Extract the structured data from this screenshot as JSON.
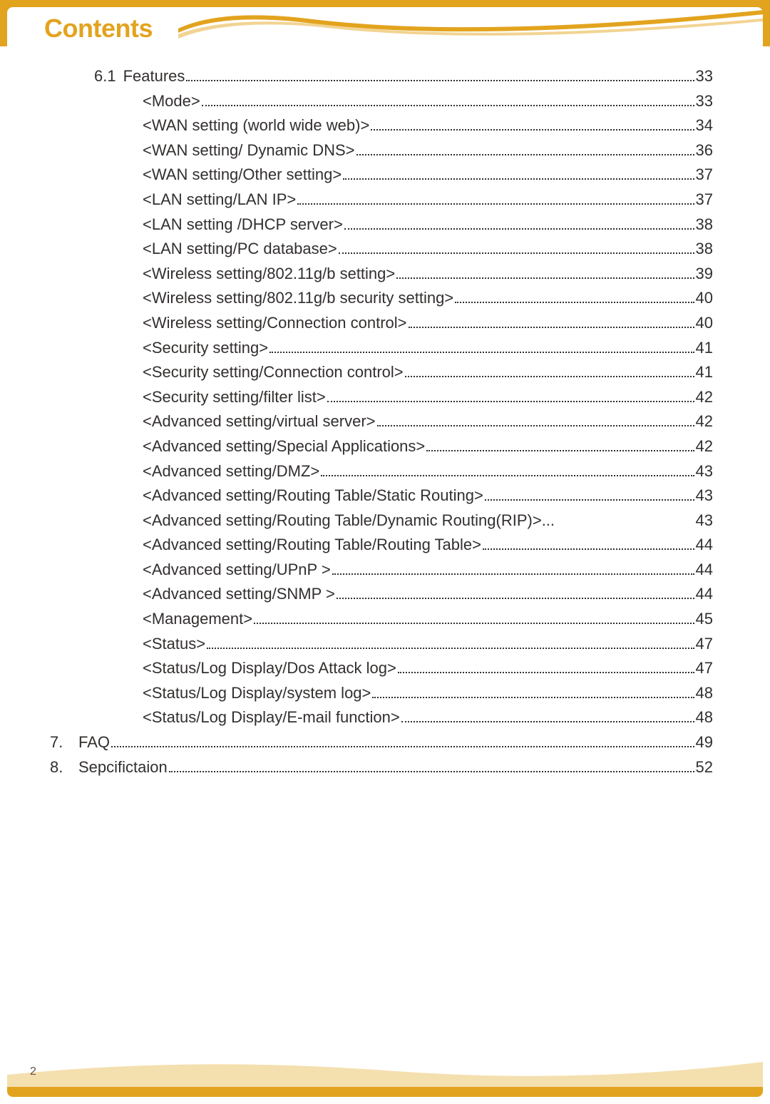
{
  "title": "Contents",
  "page_number": "2",
  "entries": [
    {
      "num": "6.1",
      "label": "Features",
      "page": "33",
      "level": 1
    },
    {
      "num": "",
      "label": "<Mode>",
      "page": "33",
      "level": 2
    },
    {
      "num": "",
      "label": "<WAN setting (world wide web)>",
      "page": "34",
      "level": 2
    },
    {
      "num": "",
      "label": "<WAN  setting/  Dynamic  DNS>",
      "page": "36",
      "level": 2
    },
    {
      "num": "",
      "label": "<WAN  setting/Other  setting>",
      "page": "37",
      "level": 2
    },
    {
      "num": "",
      "label": "<LAN   setting/LAN   IP>",
      "page": "37",
      "level": 2
    },
    {
      "num": "",
      "label": "<LAN setting /DHCP server>",
      "page": "38",
      "level": 2
    },
    {
      "num": "",
      "label": "<LAN setting/PC database>",
      "page": "38",
      "level": 2
    },
    {
      "num": "",
      "label": "<Wireless  setting/802.11g/b  setting>",
      "page": "39",
      "level": 2
    },
    {
      "num": "",
      "label": "<Wireless  setting/802.11g/b  security  setting>",
      "page": "40",
      "level": 2
    },
    {
      "num": "",
      "label": "<Wireless setting/Connection control>",
      "page": "40",
      "level": 2
    },
    {
      "num": "",
      "label": "<Security    setting>",
      "page": "41",
      "level": 2
    },
    {
      "num": "",
      "label": "<Security  setting/Connection  control>",
      "page": "41",
      "level": 2
    },
    {
      "num": "",
      "label": "<Security  setting/filter  list>",
      "page": "42",
      "level": 2
    },
    {
      "num": "",
      "label": "<Advanced  setting/virtual  server>",
      "page": "42",
      "level": 2
    },
    {
      "num": "",
      "label": "<Advanced  setting/Special  Applications>",
      "page": "42",
      "level": 2
    },
    {
      "num": "",
      "label": "<Advanced    setting/DMZ>",
      "page": "43",
      "level": 2
    },
    {
      "num": "",
      "label": "<Advanced setting/Routing Table/Static Routing>",
      "page": "43",
      "level": 2
    },
    {
      "num": "",
      "label": "<Advanced setting/Routing Table/Dynamic Routing(RIP)>",
      "page": "43",
      "level": 2,
      "short_leader": true
    },
    {
      "num": "",
      "label": "<Advanced setting/Routing Table/Routing Table>",
      "page": "44",
      "level": 2
    },
    {
      "num": "",
      "label": "<Advanced  setting/UPnP >",
      "page": "44",
      "level": 2
    },
    {
      "num": "",
      "label": "<Advanced  setting/SNMP >",
      "page": "44",
      "level": 2
    },
    {
      "num": "",
      "label": "<Management>",
      "page": "45",
      "level": 2
    },
    {
      "num": "",
      "label": "<Status>",
      "page": "47",
      "level": 2
    },
    {
      "num": "",
      "label": "<Status/Log Display/Dos Attack log>",
      "page": "47",
      "level": 2
    },
    {
      "num": "",
      "label": "<Status/Log  Display/system  log>",
      "page": "48",
      "level": 2
    },
    {
      "num": "",
      "label": "<Status/Log  Display/E-mail  function>",
      "page": "48",
      "level": 2
    },
    {
      "num": "7.",
      "label": "FAQ",
      "page": "49",
      "level": 0
    },
    {
      "num": "8.",
      "label": "Sepcifictaion",
      "page": " 52",
      "level": 0
    }
  ]
}
